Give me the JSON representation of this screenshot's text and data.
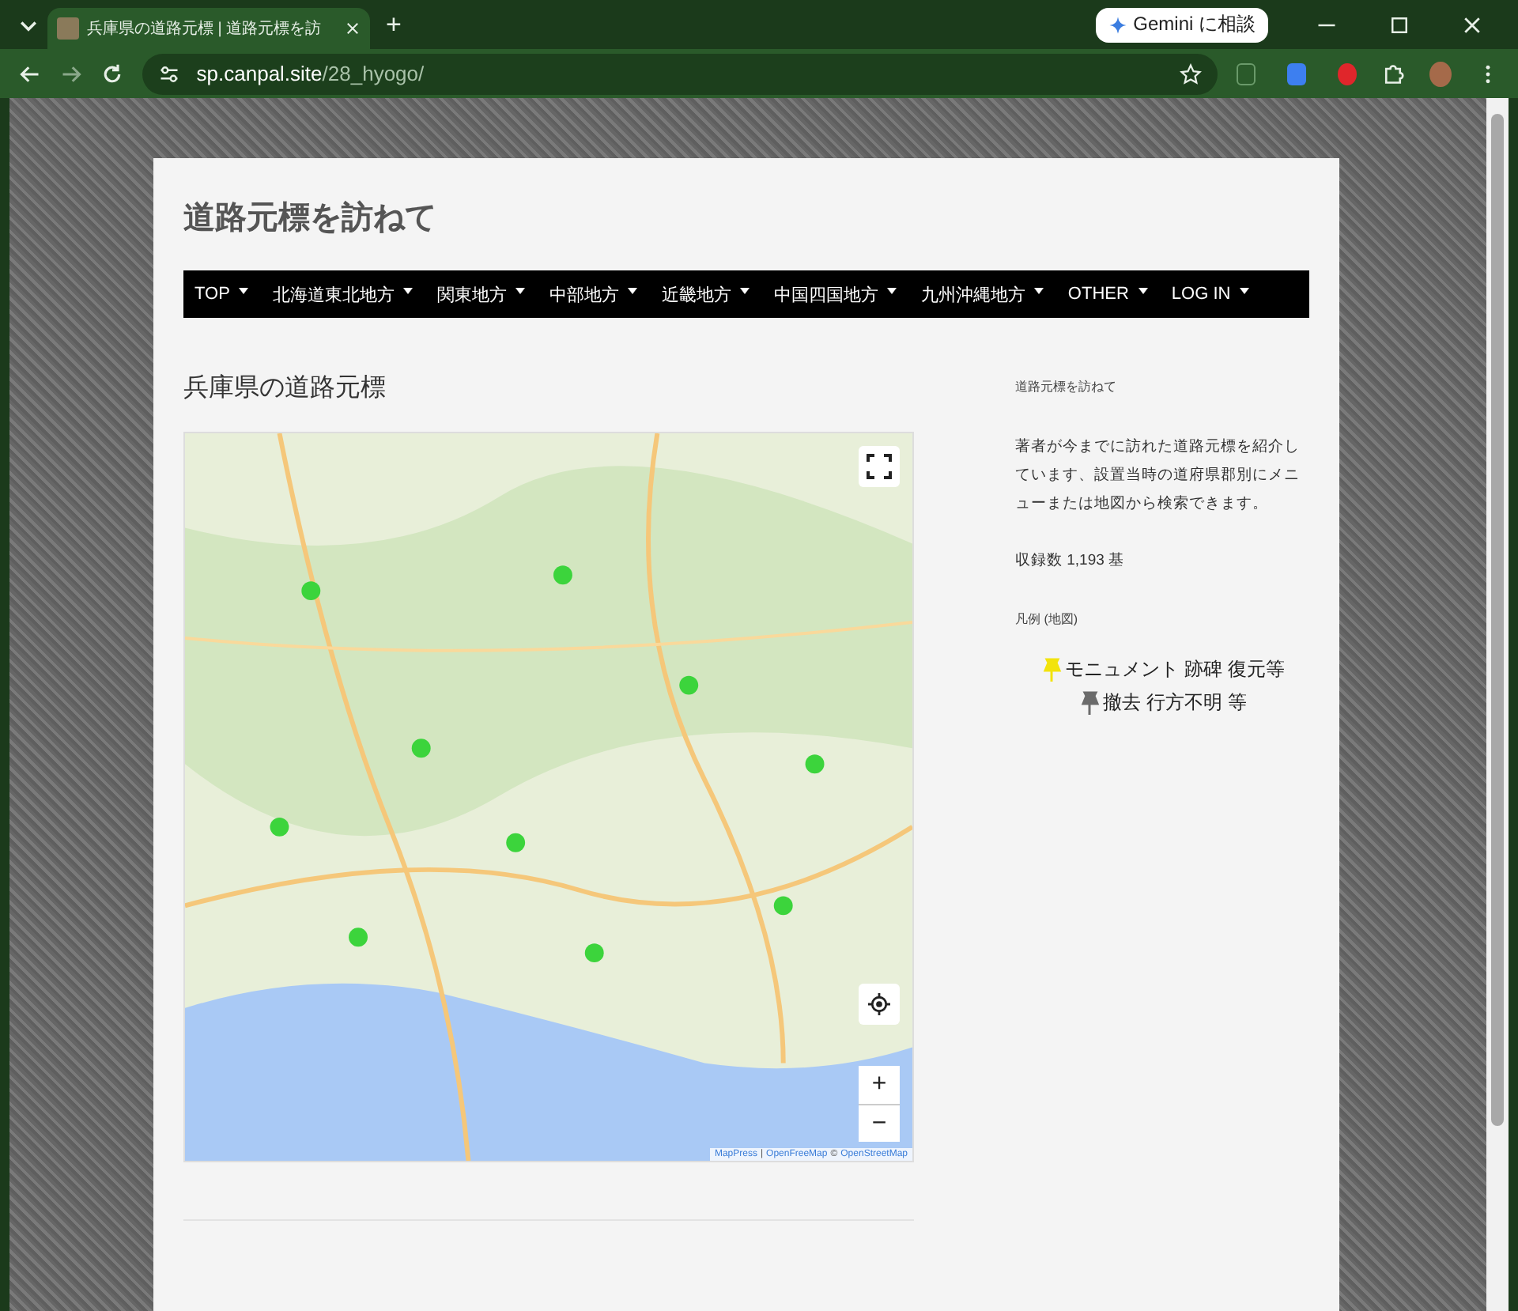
{
  "browser": {
    "tab_title": "兵庫県の道路元標 | 道路元標を訪",
    "new_tab": "+",
    "gemini": "Gemini に相談",
    "url_host": "sp.canpal.site",
    "url_path": "/28_hyogo/"
  },
  "site": {
    "title": "道路元標を訪ねて"
  },
  "nav": [
    {
      "label": "TOP"
    },
    {
      "label": "北海道東北地方"
    },
    {
      "label": "関東地方"
    },
    {
      "label": "中部地方"
    },
    {
      "label": "近畿地方"
    },
    {
      "label": "中国四国地方"
    },
    {
      "label": "九州沖縄地方"
    },
    {
      "label": "OTHER"
    },
    {
      "label": "LOG IN"
    }
  ],
  "page": {
    "heading": "兵庫県の道路元標",
    "map": {
      "kind": "picture",
      "zoom_in": "+",
      "zoom_out": "−",
      "attribution": [
        {
          "label": "MapPress"
        },
        {
          "label": "|"
        },
        {
          "label": "OpenFreeMap"
        },
        {
          "label": "©"
        },
        {
          "label": "OpenStreetMap"
        }
      ]
    }
  },
  "sidebar": {
    "widget_title": "道路元標を訪ねて",
    "description": "著者が今までに訪れた道路元標を紹介しています、設置当時の道府県郡別にメニューまたは地図から検索できます。",
    "count": "収録数 1,193 基",
    "legend_title": "凡例 (地図)",
    "legend": [
      {
        "label": "モニュメント 跡碑 復元等",
        "color": "#f2e30c"
      },
      {
        "label": "撤去 行方不明 等",
        "color": "#6b6b6b"
      }
    ]
  }
}
